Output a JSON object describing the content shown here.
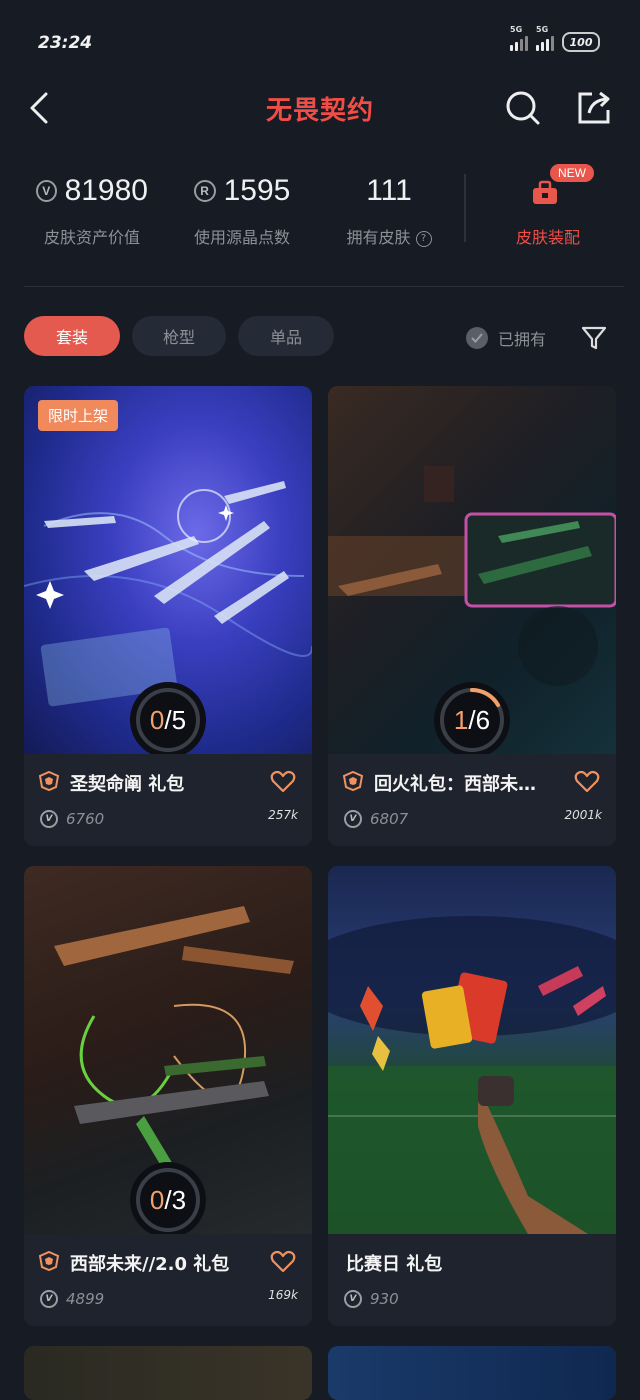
{
  "status_bar": {
    "time": "23:24",
    "network1": "5G",
    "network2": "5G",
    "battery": "100"
  },
  "app_bar": {
    "title": "无畏契约"
  },
  "stats": {
    "asset_value": "81980",
    "asset_value_label": "皮肤资产价值",
    "radianite_used": "1595",
    "radianite_used_label": "使用源晶点数",
    "skins_owned": "111",
    "skins_owned_label": "拥有皮肤",
    "outfit_badge": "NEW",
    "outfit_label": "皮肤装配"
  },
  "filters": {
    "tabs": [
      "套装",
      "枪型",
      "单品"
    ],
    "active_tab": "套装",
    "owned_label": "已拥有"
  },
  "cards": [
    {
      "title": "圣契命阐 礼包",
      "owned": "0",
      "total": "5",
      "progress": 0,
      "price": "6760",
      "likes": "257k",
      "tag": "限时上架",
      "has_shield": true
    },
    {
      "title": "回火礼包：西部未…",
      "owned": "1",
      "total": "6",
      "progress": 0.1667,
      "price": "6807",
      "likes": "2001k",
      "has_shield": true
    },
    {
      "title": "西部未来//2.0 礼包",
      "owned": "0",
      "total": "3",
      "progress": 0,
      "price": "4899",
      "likes": "169k",
      "has_shield": true
    },
    {
      "title": "比赛日 礼包",
      "price": "930",
      "has_shield": false
    }
  ],
  "colors": {
    "accent": "#ef4d46",
    "chip_active": "#e55a4f",
    "background": "#161b24",
    "card": "#1e232d",
    "progress": "#f4a06a"
  }
}
